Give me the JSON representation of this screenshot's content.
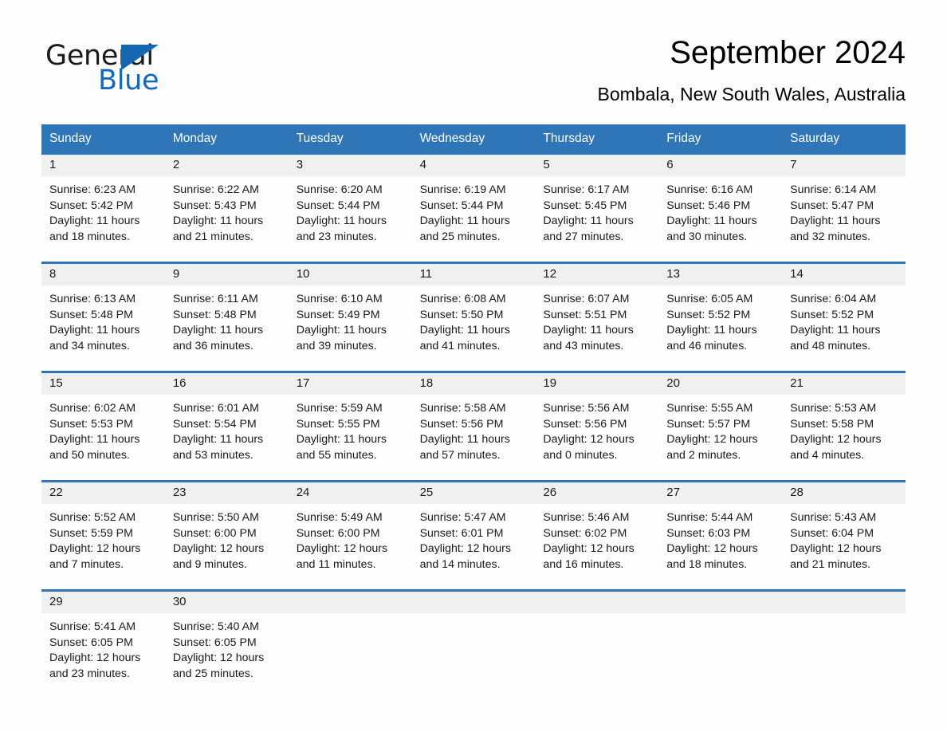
{
  "brand": {
    "word_one": "General",
    "word_two": "Blue",
    "triangle_color": "#1667b1",
    "blue_color": "#1169c4"
  },
  "header": {
    "month_title": "September 2024",
    "location": "Bombala, New South Wales, Australia"
  },
  "theme": {
    "header_blue": "#2e76b8",
    "day_band_gray": "#f0f0f0",
    "page_background": "#fdfdfd",
    "text_color": "#1a1a1a"
  },
  "weekdays": [
    "Sunday",
    "Monday",
    "Tuesday",
    "Wednesday",
    "Thursday",
    "Friday",
    "Saturday"
  ],
  "weeks": [
    [
      {
        "day": "1",
        "sunrise": "Sunrise: 6:23 AM",
        "sunset": "Sunset: 5:42 PM",
        "daylight": "Daylight: 11 hours and 18 minutes."
      },
      {
        "day": "2",
        "sunrise": "Sunrise: 6:22 AM",
        "sunset": "Sunset: 5:43 PM",
        "daylight": "Daylight: 11 hours and 21 minutes."
      },
      {
        "day": "3",
        "sunrise": "Sunrise: 6:20 AM",
        "sunset": "Sunset: 5:44 PM",
        "daylight": "Daylight: 11 hours and 23 minutes."
      },
      {
        "day": "4",
        "sunrise": "Sunrise: 6:19 AM",
        "sunset": "Sunset: 5:44 PM",
        "daylight": "Daylight: 11 hours and 25 minutes."
      },
      {
        "day": "5",
        "sunrise": "Sunrise: 6:17 AM",
        "sunset": "Sunset: 5:45 PM",
        "daylight": "Daylight: 11 hours and 27 minutes."
      },
      {
        "day": "6",
        "sunrise": "Sunrise: 6:16 AM",
        "sunset": "Sunset: 5:46 PM",
        "daylight": "Daylight: 11 hours and 30 minutes."
      },
      {
        "day": "7",
        "sunrise": "Sunrise: 6:14 AM",
        "sunset": "Sunset: 5:47 PM",
        "daylight": "Daylight: 11 hours and 32 minutes."
      }
    ],
    [
      {
        "day": "8",
        "sunrise": "Sunrise: 6:13 AM",
        "sunset": "Sunset: 5:48 PM",
        "daylight": "Daylight: 11 hours and 34 minutes."
      },
      {
        "day": "9",
        "sunrise": "Sunrise: 6:11 AM",
        "sunset": "Sunset: 5:48 PM",
        "daylight": "Daylight: 11 hours and 36 minutes."
      },
      {
        "day": "10",
        "sunrise": "Sunrise: 6:10 AM",
        "sunset": "Sunset: 5:49 PM",
        "daylight": "Daylight: 11 hours and 39 minutes."
      },
      {
        "day": "11",
        "sunrise": "Sunrise: 6:08 AM",
        "sunset": "Sunset: 5:50 PM",
        "daylight": "Daylight: 11 hours and 41 minutes."
      },
      {
        "day": "12",
        "sunrise": "Sunrise: 6:07 AM",
        "sunset": "Sunset: 5:51 PM",
        "daylight": "Daylight: 11 hours and 43 minutes."
      },
      {
        "day": "13",
        "sunrise": "Sunrise: 6:05 AM",
        "sunset": "Sunset: 5:52 PM",
        "daylight": "Daylight: 11 hours and 46 minutes."
      },
      {
        "day": "14",
        "sunrise": "Sunrise: 6:04 AM",
        "sunset": "Sunset: 5:52 PM",
        "daylight": "Daylight: 11 hours and 48 minutes."
      }
    ],
    [
      {
        "day": "15",
        "sunrise": "Sunrise: 6:02 AM",
        "sunset": "Sunset: 5:53 PM",
        "daylight": "Daylight: 11 hours and 50 minutes."
      },
      {
        "day": "16",
        "sunrise": "Sunrise: 6:01 AM",
        "sunset": "Sunset: 5:54 PM",
        "daylight": "Daylight: 11 hours and 53 minutes."
      },
      {
        "day": "17",
        "sunrise": "Sunrise: 5:59 AM",
        "sunset": "Sunset: 5:55 PM",
        "daylight": "Daylight: 11 hours and 55 minutes."
      },
      {
        "day": "18",
        "sunrise": "Sunrise: 5:58 AM",
        "sunset": "Sunset: 5:56 PM",
        "daylight": "Daylight: 11 hours and 57 minutes."
      },
      {
        "day": "19",
        "sunrise": "Sunrise: 5:56 AM",
        "sunset": "Sunset: 5:56 PM",
        "daylight": "Daylight: 12 hours and 0 minutes."
      },
      {
        "day": "20",
        "sunrise": "Sunrise: 5:55 AM",
        "sunset": "Sunset: 5:57 PM",
        "daylight": "Daylight: 12 hours and 2 minutes."
      },
      {
        "day": "21",
        "sunrise": "Sunrise: 5:53 AM",
        "sunset": "Sunset: 5:58 PM",
        "daylight": "Daylight: 12 hours and 4 minutes."
      }
    ],
    [
      {
        "day": "22",
        "sunrise": "Sunrise: 5:52 AM",
        "sunset": "Sunset: 5:59 PM",
        "daylight": "Daylight: 12 hours and 7 minutes."
      },
      {
        "day": "23",
        "sunrise": "Sunrise: 5:50 AM",
        "sunset": "Sunset: 6:00 PM",
        "daylight": "Daylight: 12 hours and 9 minutes."
      },
      {
        "day": "24",
        "sunrise": "Sunrise: 5:49 AM",
        "sunset": "Sunset: 6:00 PM",
        "daylight": "Daylight: 12 hours and 11 minutes."
      },
      {
        "day": "25",
        "sunrise": "Sunrise: 5:47 AM",
        "sunset": "Sunset: 6:01 PM",
        "daylight": "Daylight: 12 hours and 14 minutes."
      },
      {
        "day": "26",
        "sunrise": "Sunrise: 5:46 AM",
        "sunset": "Sunset: 6:02 PM",
        "daylight": "Daylight: 12 hours and 16 minutes."
      },
      {
        "day": "27",
        "sunrise": "Sunrise: 5:44 AM",
        "sunset": "Sunset: 6:03 PM",
        "daylight": "Daylight: 12 hours and 18 minutes."
      },
      {
        "day": "28",
        "sunrise": "Sunrise: 5:43 AM",
        "sunset": "Sunset: 6:04 PM",
        "daylight": "Daylight: 12 hours and 21 minutes."
      }
    ],
    [
      {
        "day": "29",
        "sunrise": "Sunrise: 5:41 AM",
        "sunset": "Sunset: 6:05 PM",
        "daylight": "Daylight: 12 hours and 23 minutes."
      },
      {
        "day": "30",
        "sunrise": "Sunrise: 5:40 AM",
        "sunset": "Sunset: 6:05 PM",
        "daylight": "Daylight: 12 hours and 25 minutes."
      },
      {
        "day": "",
        "sunrise": "",
        "sunset": "",
        "daylight": ""
      },
      {
        "day": "",
        "sunrise": "",
        "sunset": "",
        "daylight": ""
      },
      {
        "day": "",
        "sunrise": "",
        "sunset": "",
        "daylight": ""
      },
      {
        "day": "",
        "sunrise": "",
        "sunset": "",
        "daylight": ""
      },
      {
        "day": "",
        "sunrise": "",
        "sunset": "",
        "daylight": ""
      }
    ]
  ]
}
